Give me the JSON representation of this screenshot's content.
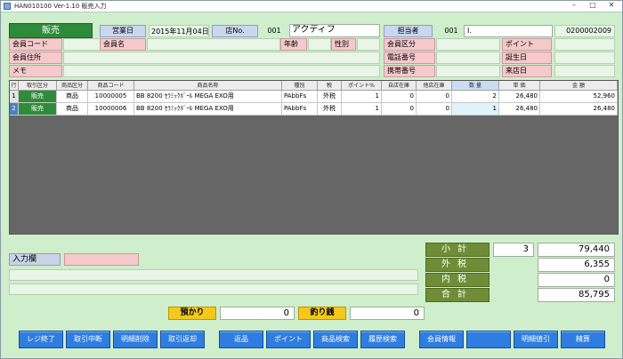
{
  "window": {
    "title": "HAN010100 Ver-1.10 販売入力",
    "minimize": "–",
    "maximize": "□",
    "close": "✕"
  },
  "header": {
    "mode": "販売",
    "business_day_label": "営業日",
    "business_day": "2015年11月04日",
    "store_no_label": "店No.",
    "store_no": "001",
    "store_name": "アクディフ",
    "staff_label": "担当者",
    "staff_code": "001",
    "staff_name": "I.",
    "slip_no": "0200002009"
  },
  "member": {
    "code_label": "会員コード",
    "name_label": "会員名",
    "age_label": "年齢",
    "gender_label": "性別",
    "class_label": "会員区分",
    "point_label": "ポイント",
    "address_label": "会員住所",
    "phone_label": "電話番号",
    "birthday_label": "誕生日",
    "memo_label": "メモ",
    "mobile_label": "携帯番号",
    "visit_label": "来店日"
  },
  "grid": {
    "columns": [
      "行",
      "取引区分",
      "商品区分",
      "商品コード",
      "商品名称",
      "種別",
      "税",
      "ポイント%",
      "自店在庫",
      "他店在庫",
      "数 量",
      "単 価",
      "金 額"
    ],
    "rows": [
      {
        "line": "1",
        "txn": "販売",
        "cat": "商品",
        "code": "10000005",
        "name": "BB 8200 ｾﾗﾐｯｸﾎﾞｰﾙ MEGA EXO用",
        "type": "PAbbFs",
        "tax": "外税",
        "point": "1",
        "own_stock": "0",
        "other_stock": "0",
        "qty": "2",
        "unit_price": "26,480",
        "amount": "52,960"
      },
      {
        "line": "2",
        "txn": "販売",
        "cat": "商品",
        "code": "10000006",
        "name": "BB 8200 ｾﾗﾐｯｸﾎﾞｰﾙ MEGA EXO用",
        "type": "PAbbFs",
        "tax": "外税",
        "point": "1",
        "own_stock": "0",
        "other_stock": "0",
        "qty": "1",
        "unit_price": "26,480",
        "amount": "26,480"
      }
    ]
  },
  "input": {
    "label": "入力欄",
    "value": ""
  },
  "totals": {
    "subtotal_label": "小計",
    "subtotal_qty": "3",
    "subtotal": "79,440",
    "ext_tax_label": "外税",
    "ext_tax": "6,355",
    "inc_tax_label": "内税",
    "inc_tax": "0",
    "total_label": "合計",
    "total": "85,795"
  },
  "payment": {
    "deposit_label": "預かり",
    "deposit": "0",
    "change_label": "釣り銭",
    "change": "0"
  },
  "buttons": {
    "register_end": "レジ終了",
    "txn_interrupt": "取引中断",
    "detail_delete": "明細削除",
    "txn_return": "取引返却",
    "return_goods": "返品",
    "point": "ポイント",
    "product_search": "商品検索",
    "history_search": "履歴検索",
    "member_info": "会員情報",
    "blank": "",
    "detail_discount": "明細値引",
    "checkout": "精算"
  },
  "colors": {
    "background": "#cfeecb",
    "button": "#2f7de0",
    "mode": "#2e8b3a",
    "label_pink": "#f6c9cc",
    "label_blue": "#cbd7ef",
    "total_label": "#6f8d36",
    "payment_label": "#f5c81b"
  }
}
